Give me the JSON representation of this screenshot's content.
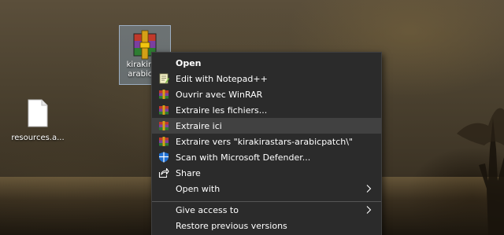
{
  "desktop": {
    "icons": [
      {
        "label_line1": "kirakirast",
        "label_line2": "arabicpa",
        "selected": true
      },
      {
        "label": "resources.a..."
      }
    ]
  },
  "context_menu": {
    "items": [
      {
        "label": "Open",
        "bold": true,
        "icon": "none"
      },
      {
        "label": "Edit with Notepad++",
        "icon": "notepad-plus-plus-icon"
      },
      {
        "label": "Ouvrir avec WinRAR",
        "icon": "winrar-icon"
      },
      {
        "label": "Extraire les fichiers...",
        "icon": "winrar-icon"
      },
      {
        "label": "Extraire ici",
        "icon": "winrar-icon",
        "highlighted": true
      },
      {
        "label": "Extraire vers \"kirakirastars-arabicpatch\\\"",
        "icon": "winrar-icon"
      },
      {
        "label": "Scan with Microsoft Defender...",
        "icon": "defender-shield-icon"
      },
      {
        "label": "Share",
        "icon": "share-icon"
      },
      {
        "label": "Open with",
        "icon": "none",
        "submenu": true
      },
      {
        "label": "Give access to",
        "icon": "none",
        "submenu": true
      },
      {
        "label": "Restore previous versions",
        "icon": "none"
      }
    ]
  },
  "colors": {
    "menu_bg": "#2b2b2b",
    "menu_highlight": "#414141",
    "menu_text": "#ffffff",
    "selection": "#99bee6",
    "defender_blue": "#1f6fd1"
  }
}
